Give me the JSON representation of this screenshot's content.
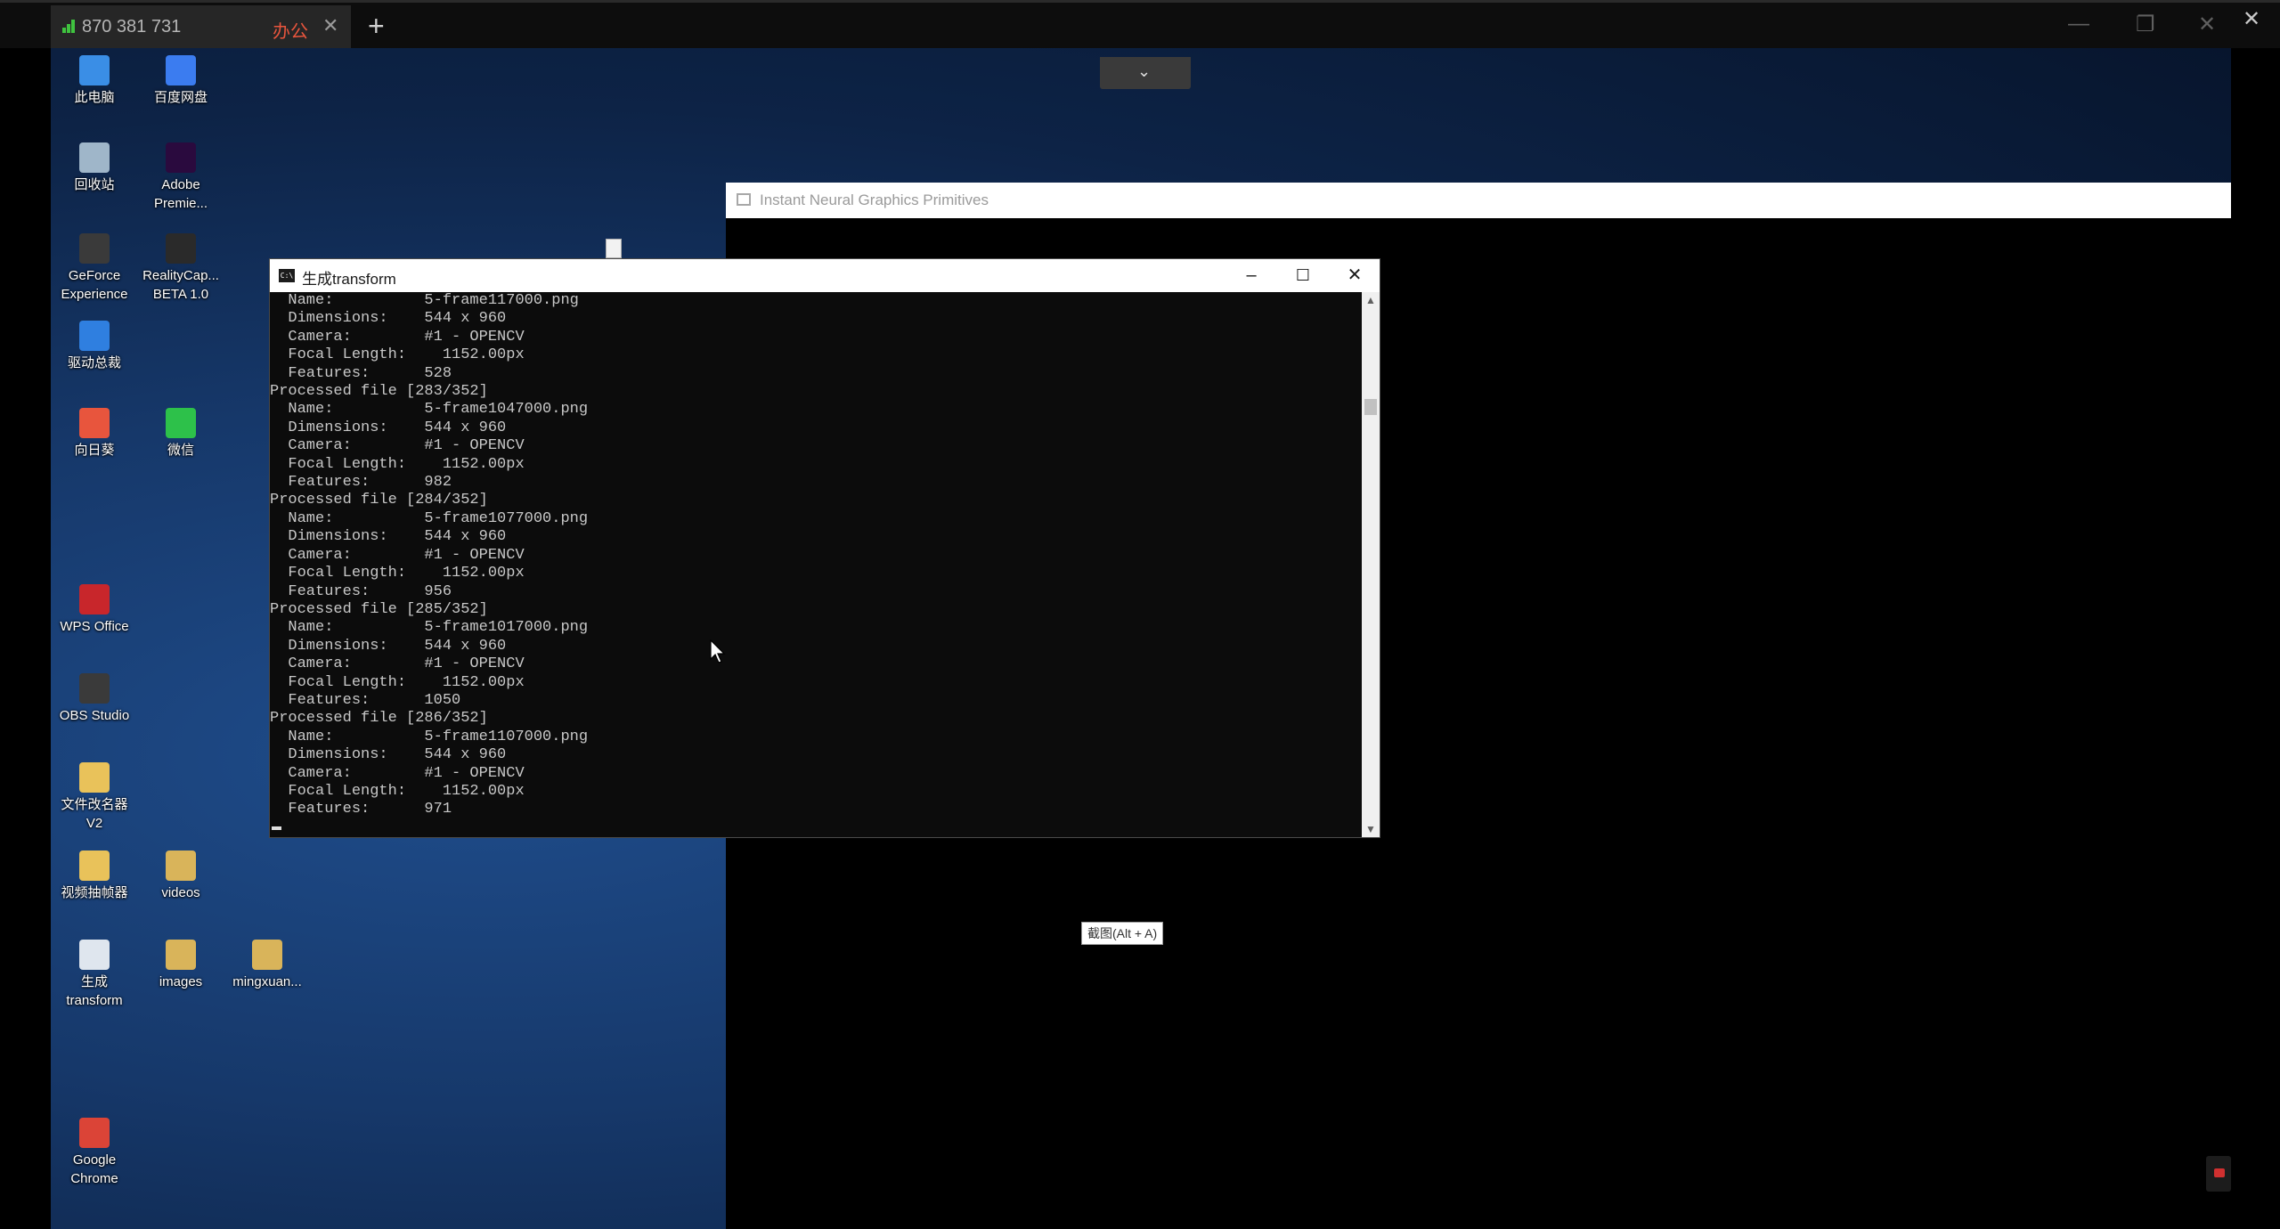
{
  "remote_client": {
    "connection_id": "870 381 731",
    "session_label": "办公",
    "tab_close": "✕",
    "new_tab": "+",
    "far_close": "✕"
  },
  "desktop_icons": [
    {
      "label": "此电脑",
      "icon": "computer-icon",
      "color": "#3a8ee6"
    },
    {
      "label": "百度网盘",
      "icon": "baidu-netdisk-icon",
      "color": "#3b7cf0"
    },
    {
      "label": "回收站",
      "icon": "recycle-bin-icon",
      "color": "#9fb6c9"
    },
    {
      "label": "Adobe Premie...",
      "icon": "premiere-icon",
      "color": "#2a0a3e"
    },
    {
      "label": "GeForce Experience",
      "icon": "geforce-icon",
      "color": "#3a3a3a"
    },
    {
      "label": "RealityCap... BETA 1.0",
      "icon": "realitycapture-icon",
      "color": "#2a2a2a"
    },
    {
      "label": "驱动总裁",
      "icon": "driver-icon",
      "color": "#2f7fe0"
    },
    {
      "label": "向日葵",
      "icon": "sunflower-icon",
      "color": "#e8553d"
    },
    {
      "label": "微信",
      "icon": "wechat-icon",
      "color": "#2dc14a"
    },
    {
      "label": "WPS Office",
      "icon": "wps-icon",
      "color": "#c8262b"
    },
    {
      "label": "OBS Studio",
      "icon": "obs-icon",
      "color": "#3a3a3a"
    },
    {
      "label": "文件改名器 V2",
      "icon": "renamer-icon",
      "color": "#e9c25a"
    },
    {
      "label": "视频抽帧器",
      "icon": "frame-extractor-icon",
      "color": "#e9c25a"
    },
    {
      "label": "videos",
      "icon": "folder-icon",
      "color": "#d9b45a"
    },
    {
      "label": "生成 transform",
      "icon": "script-file-icon",
      "color": "#dfe6ee"
    },
    {
      "label": "images",
      "icon": "folder-icon",
      "color": "#d9b45a"
    },
    {
      "label": "mingxuan...",
      "icon": "folder-icon",
      "color": "#d9b45a"
    },
    {
      "label": "Google Chrome",
      "icon": "chrome-icon",
      "color": "#db4437"
    }
  ],
  "ngp_window": {
    "title": "Instant Neural Graphics Primitives"
  },
  "console": {
    "title": "生成transform",
    "icon_text": "C:\\",
    "minimize": "–",
    "maximize": "☐",
    "close": "✕",
    "lines": [
      "  Name:          5-frame117000.png",
      "  Dimensions:    544 x 960",
      "  Camera:        #1 - OPENCV",
      "  Focal Length:    1152.00px",
      "  Features:      528",
      "Processed file [283/352]",
      "  Name:          5-frame1047000.png",
      "  Dimensions:    544 x 960",
      "  Camera:        #1 - OPENCV",
      "  Focal Length:    1152.00px",
      "  Features:      982",
      "Processed file [284/352]",
      "  Name:          5-frame1077000.png",
      "  Dimensions:    544 x 960",
      "  Camera:        #1 - OPENCV",
      "  Focal Length:    1152.00px",
      "  Features:      956",
      "Processed file [285/352]",
      "  Name:          5-frame1017000.png",
      "  Dimensions:    544 x 960",
      "  Camera:        #1 - OPENCV",
      "  Focal Length:    1152.00px",
      "  Features:      1050",
      "Processed file [286/352]",
      "  Name:          5-frame1107000.png",
      "  Dimensions:    544 x 960",
      "  Camera:        #1 - OPENCV",
      "  Focal Length:    1152.00px",
      "  Features:      971"
    ]
  },
  "tooltip": "截图(Alt + A)",
  "colors": {
    "console_bg": "#0c0c0c",
    "console_text": "#c8c8c8",
    "signal_green": "#3fc33f",
    "session_red": "#e8553d"
  }
}
